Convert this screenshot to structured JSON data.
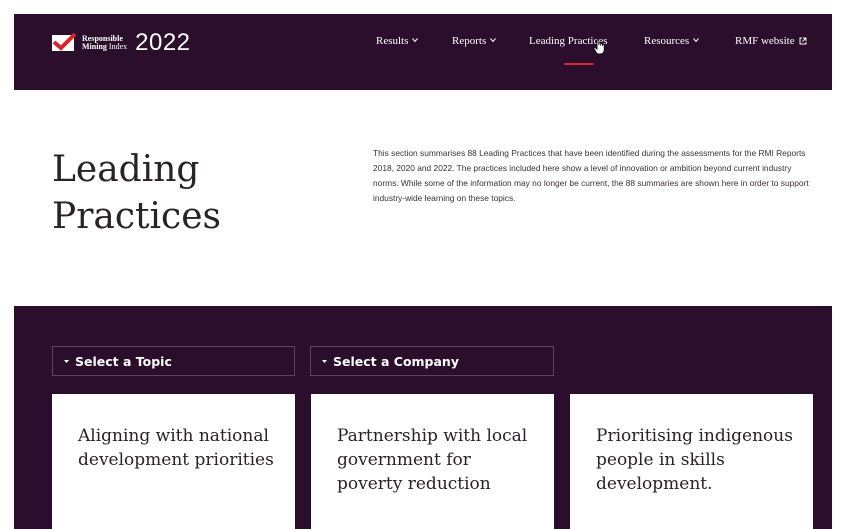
{
  "brand": {
    "line1": "Responsible",
    "line2a": "Mining",
    "line2b": "Index",
    "year": "2022",
    "accent_color": "#d9242b",
    "bg_color": "#2a0e2c"
  },
  "nav": {
    "items": [
      {
        "label": "Results",
        "icon": "chevron-down-icon"
      },
      {
        "label": "Reports",
        "icon": "chevron-down-icon"
      },
      {
        "label": "Leading Practices",
        "icon": ""
      },
      {
        "label": "Resources",
        "icon": "chevron-down-icon"
      },
      {
        "label": "RMF website",
        "icon": "external-link-icon"
      }
    ],
    "active_index": 2
  },
  "hero": {
    "title_line1": "Leading",
    "title_line2": "Practices",
    "description": "This section summarises 88 Leading Practices that have been identified during the assessments for the RMI Reports 2018, 2020 and 2022. The practices included here show a level of innovation or ambition beyond current industry norms. While some of the information may no longer be current, the 88 summaries are shown here in order to support industry-wide learning on these topics."
  },
  "filters": {
    "topic_label": "Select a Topic",
    "company_label": "Select a Company"
  },
  "cards": [
    {
      "title": "Aligning with national development priorities"
    },
    {
      "title": "Partnership with local government for poverty reduction"
    },
    {
      "title": "Prioritising indigenous people in skills development."
    }
  ]
}
